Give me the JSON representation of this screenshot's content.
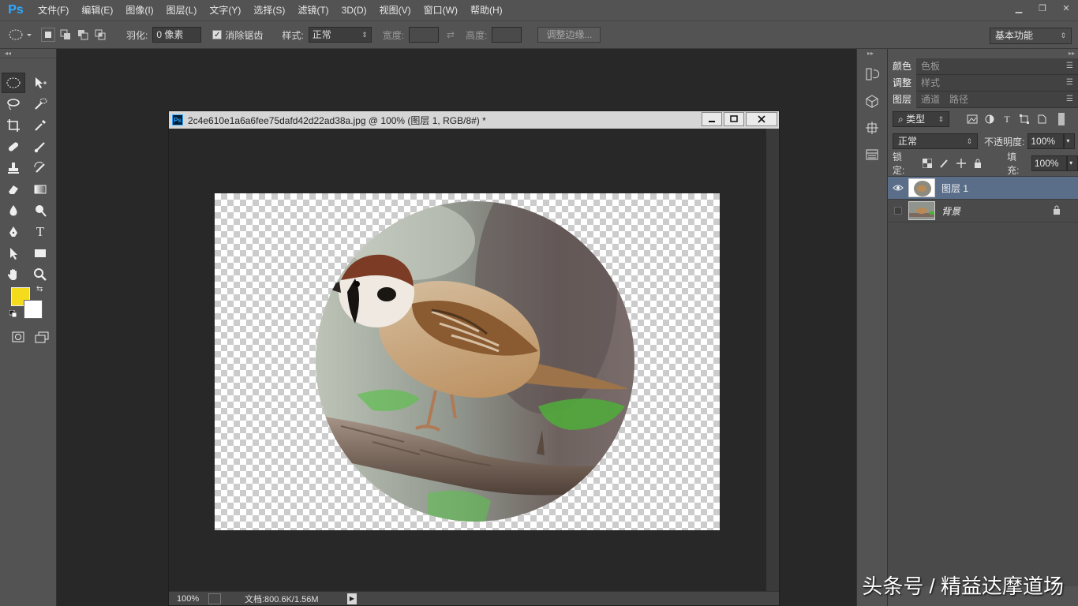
{
  "app": {
    "logo": "Ps"
  },
  "menu": [
    "文件(F)",
    "编辑(E)",
    "图像(I)",
    "图层(L)",
    "文字(Y)",
    "选择(S)",
    "滤镜(T)",
    "3D(D)",
    "视图(V)",
    "窗口(W)",
    "帮助(H)"
  ],
  "window_controls": {
    "minimize": "▁",
    "restore": "❐",
    "close": "✕"
  },
  "options": {
    "feather_label": "羽化:",
    "feather_value": "0 像素",
    "antialias_label": "消除锯齿",
    "antialias_checked": true,
    "style_label": "样式:",
    "style_value": "正常",
    "width_label": "宽度:",
    "height_label": "高度:",
    "refine_edge": "调整边缘...",
    "workspace": "基本功能"
  },
  "colors": {
    "foreground": "#f4dc1c",
    "background": "#ffffff",
    "accent": "#31a8ff"
  },
  "document": {
    "icon": "Ps",
    "title": "2c4e610e1a6a6fee75dafd42d22ad38a.jpg @ 100% (图层 1, RGB/8#) *",
    "zoom": "100%",
    "doc_info": "文档:800.6K/1.56M"
  },
  "panels": {
    "group1": [
      "颜色",
      "色板"
    ],
    "group2": [
      "调整",
      "样式"
    ],
    "group3": [
      "图层",
      "通道",
      "路径"
    ],
    "filter_kind": "类型",
    "blend_mode": "正常",
    "opacity_label": "不透明度:",
    "opacity_value": "100%",
    "lock_label": "锁定:",
    "fill_label": "填充:",
    "fill_value": "100%",
    "layers": [
      {
        "name": "图层 1",
        "selected": true,
        "visible": true
      },
      {
        "name": "背景",
        "selected": false,
        "visible": false,
        "locked": true
      }
    ]
  },
  "watermark": "头条号 / 精益达摩道场"
}
